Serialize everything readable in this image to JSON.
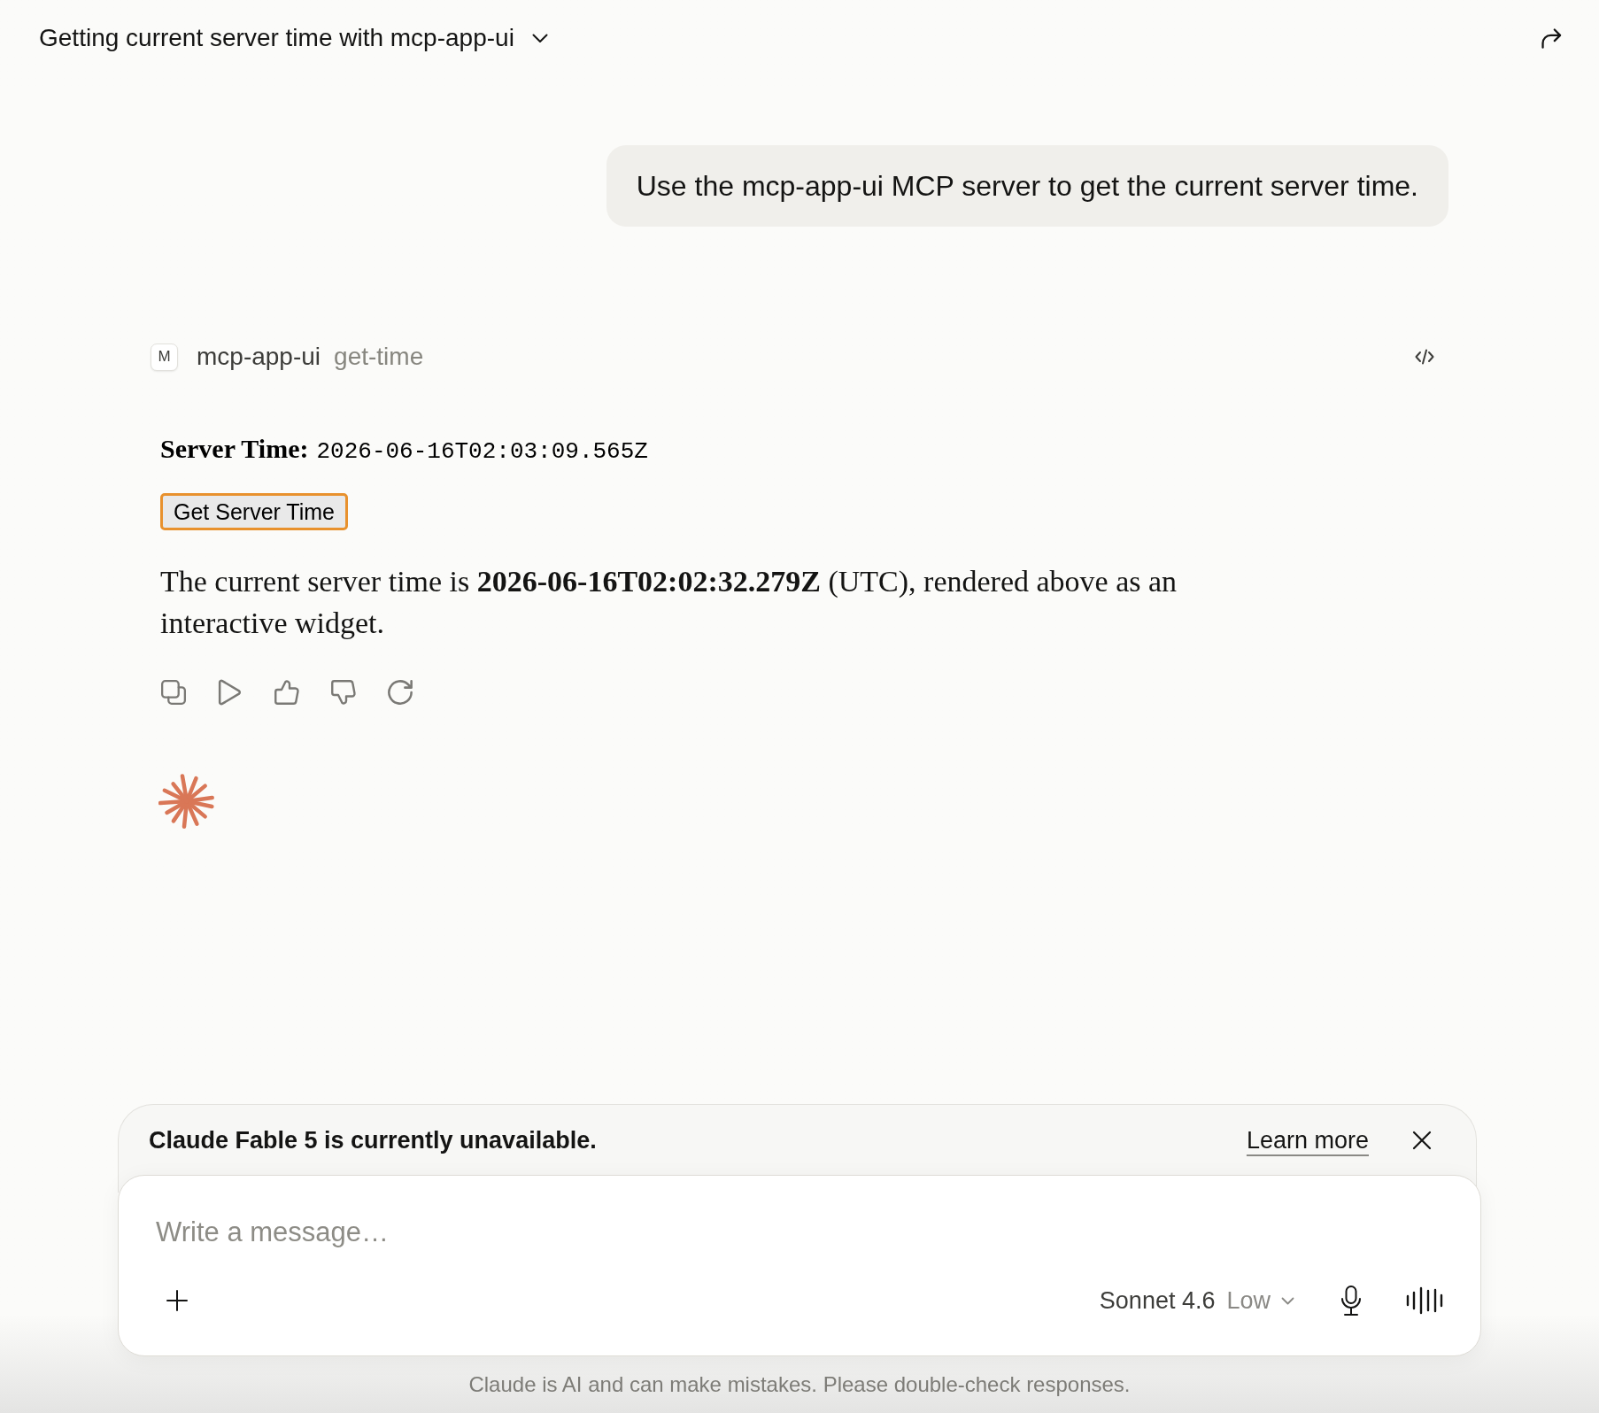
{
  "header": {
    "title": "Getting current server time with mcp-app-ui"
  },
  "user_message": {
    "text": "Use the mcp-app-ui MCP server to get the current server time."
  },
  "tool_call": {
    "badge": "M",
    "server": "mcp-app-ui",
    "tool": "get-time"
  },
  "widget": {
    "label": "Server Time:",
    "value": "2026-06-16T02:03:09.565Z",
    "button": {
      "label": "Get Server Time",
      "focused": true
    }
  },
  "response": {
    "text": "The current server time is **2026-06-16T02:02:32.279Z** (UTC), rendered above as an interactive widget."
  },
  "notice": {
    "text": "Claude Fable 5 is currently unavailable.",
    "link": "Learn more"
  },
  "composer": {
    "placeholder": "Write a message…",
    "model": "Sonnet 4.6",
    "effort": "Low"
  },
  "disclaimer": "Claude is AI and can make mistakes. Please double-check responses."
}
